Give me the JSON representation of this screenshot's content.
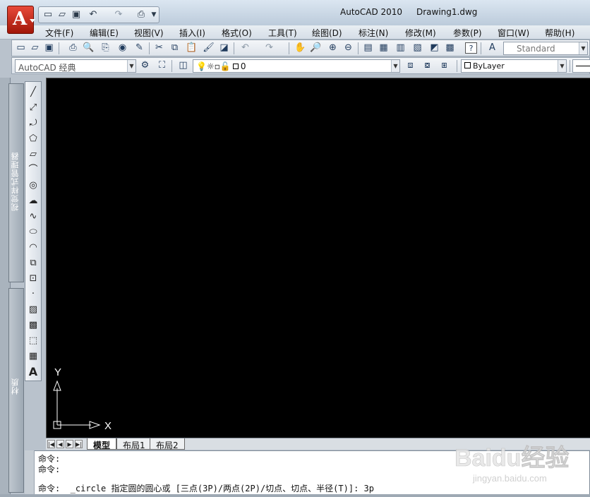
{
  "app": {
    "logo_letter": "A",
    "name": "AutoCAD 2010",
    "document": "Drawing1.dwg"
  },
  "quick_access": [
    "new-icon",
    "open-icon",
    "save-icon",
    "undo-icon",
    "redo-icon",
    "plot-icon",
    "dropdown-icon"
  ],
  "menu": [
    "文件(F)",
    "编辑(E)",
    "视图(V)",
    "插入(I)",
    "格式(O)",
    "工具(T)",
    "绘图(D)",
    "标注(N)",
    "修改(M)",
    "参数(P)",
    "窗口(W)",
    "帮助(H)"
  ],
  "toolbar_standard": {
    "text_style": "Standard",
    "icons": [
      "new-icon",
      "open-icon",
      "save-icon",
      "plot-icon",
      "plot-preview-icon",
      "publish-icon",
      "3d-print-icon",
      "design-center-icon",
      "cut-icon",
      "copy-icon",
      "paste-icon",
      "match-properties-icon",
      "block-editor-icon",
      "undo-icon",
      "redo-icon",
      "pan-icon",
      "zoom-realtime-icon",
      "zoom-window-icon",
      "zoom-previous-icon",
      "properties-icon",
      "design-center-palette-icon",
      "tool-palettes-icon",
      "sheet-set-icon",
      "markup-icon",
      "quickcalc-icon",
      "help-icon",
      "text-style-icon"
    ]
  },
  "toolbar_workspace": {
    "workspace": "AutoCAD 经典",
    "layer": "0",
    "color": "ByLayer"
  },
  "side_panels": {
    "visual_styles": "视觉样式管理器",
    "materials": "材质"
  },
  "draw_tools": [
    "line-icon",
    "construction-line-icon",
    "polyline-icon",
    "polygon-icon",
    "rectangle-icon",
    "arc-icon",
    "circle-icon",
    "revision-cloud-icon",
    "spline-icon",
    "ellipse-icon",
    "ellipse-arc-icon",
    "insert-block-icon",
    "make-block-icon",
    "point-icon",
    "hatch-icon",
    "gradient-icon",
    "region-icon",
    "table-icon",
    "multiline-text-icon"
  ],
  "ucs": {
    "x_label": "X",
    "y_label": "Y"
  },
  "layout_tabs": [
    "模型",
    "布局1",
    "布局2"
  ],
  "command_lines": [
    "命令:",
    "命令:",
    "命令:  _circle 指定圆的圆心或 [三点(3P)/两点(2P)/切点、切点、半径(T)]: 3p"
  ],
  "watermark": {
    "brand": "Baidu经验",
    "url": "jingyan.baidu.com"
  },
  "colors": {
    "canvas": "#000000",
    "logo": "#c62a1a",
    "ucs": "#ffffff"
  }
}
